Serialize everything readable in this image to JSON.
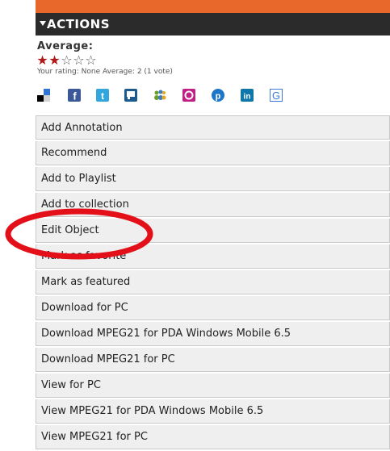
{
  "header": {
    "title": "ACTIONS"
  },
  "rating": {
    "label": "Average:",
    "stars_filled": 2,
    "stars_total": 5,
    "info": "Your rating: None Average: 2 (1 vote)"
  },
  "social": {
    "icons": [
      "delicious-icon",
      "facebook-icon",
      "twitter-icon",
      "digg-icon",
      "myspace-icon",
      "orkut-icon",
      "pinterest-icon",
      "linkedin-icon",
      "google-icon"
    ]
  },
  "menu": {
    "items": [
      "Add Annotation",
      "Recommend",
      "Add to Playlist",
      "Add to collection",
      "Edit Object",
      "Mark as favorite",
      "Mark as featured",
      "Download for PC",
      "Download MPEG21 for PDA Windows Mobile 6.5",
      "Download MPEG21 for PC",
      "View for PC",
      "View MPEG21 for PDA Windows Mobile 6.5",
      "View MPEG21 for PC"
    ]
  },
  "colors": {
    "accent": "#e8672a",
    "header_bg": "#2b2b2b",
    "star": "#b01919",
    "annotation": "#e3101a"
  }
}
